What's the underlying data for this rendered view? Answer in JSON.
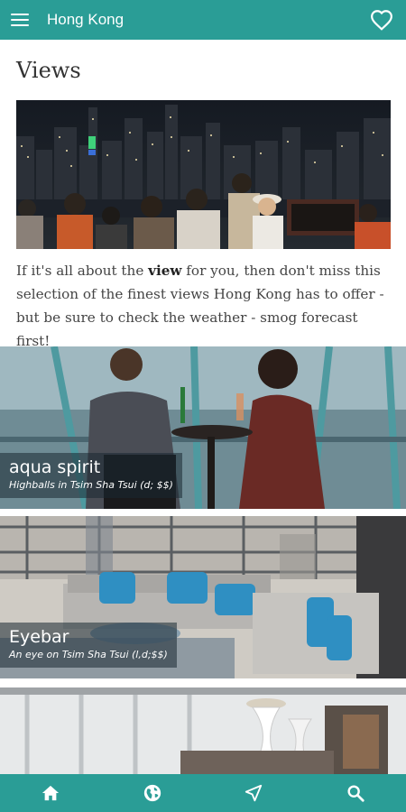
{
  "app": {
    "title": "Hong Kong",
    "colors": {
      "primary": "#2a9d96",
      "title_text": "#333333",
      "body_text": "#444444"
    }
  },
  "header": {
    "menu_icon": "menu-icon",
    "favorite_icon": "heart-icon"
  },
  "main": {
    "title": "Views",
    "intro": {
      "part1": "If it's all about the ",
      "bold": "view",
      "part2": " for you, then don't miss this selection of the finest views Hong Kong has to offer - but be sure to check the weather - smog forecast first!"
    },
    "cards": [
      {
        "name": "aqua spirit",
        "subtitle": "Highballs in Tsim Sha Tsui (d; $$)"
      },
      {
        "name": "Eyebar",
        "subtitle": "An eye on Tsim Sha Tsui (l,d;$$)"
      }
    ]
  },
  "bottom_nav": {
    "items": [
      {
        "icon": "home-icon"
      },
      {
        "icon": "globe-icon"
      },
      {
        "icon": "navigation-icon"
      },
      {
        "icon": "search-icon"
      }
    ]
  }
}
